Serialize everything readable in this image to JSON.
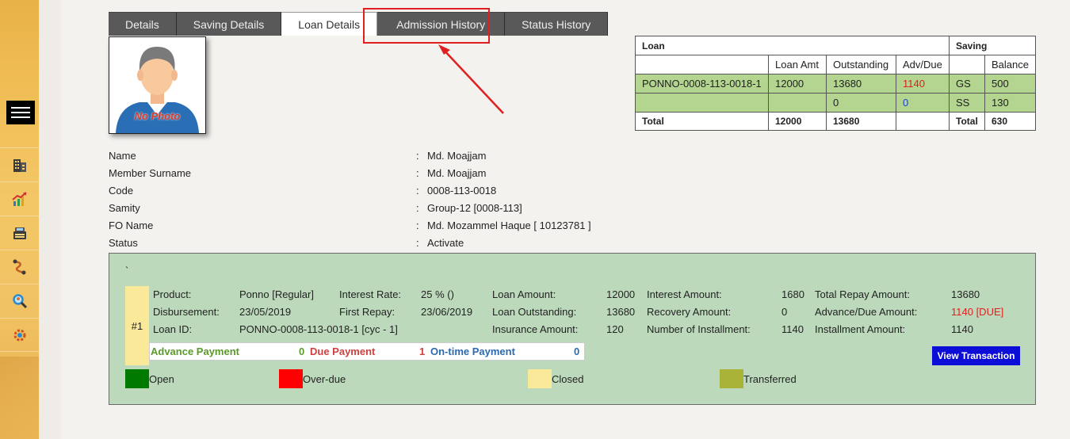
{
  "colors": {
    "sidebar": "#f0bd55",
    "tab_bg": "#595959",
    "panel_bg": "#bcdabb",
    "row_green": "#b3d58f",
    "highlight_outline": "#e02020",
    "button_blue": "#0d0dd8",
    "legend_open": "#007a00",
    "legend_overdue": "#ff0000",
    "legend_closed": "#fbe99a",
    "legend_transferred": "#a9b337"
  },
  "sidebar": {
    "menu_icon": "hamburger-menu-icon",
    "items": [
      {
        "icon": "building-icon"
      },
      {
        "icon": "chart-growth-icon"
      },
      {
        "icon": "cash-register-icon"
      },
      {
        "icon": "route-icon"
      },
      {
        "icon": "search-people-icon"
      },
      {
        "icon": "settings-gear-icon"
      }
    ]
  },
  "tabs": [
    {
      "label": "Details"
    },
    {
      "label": "Saving Details"
    },
    {
      "label": "Loan Details",
      "active": true
    },
    {
      "label": "Admission History"
    },
    {
      "label": "Status History"
    }
  ],
  "photo": {
    "placeholder_text": "No Photo"
  },
  "summary": {
    "loan_header": "Loan",
    "saving_header": "Saving",
    "col_loan_amt": "Loan Amt",
    "col_outstanding": "Outstanding",
    "col_adv_due": "Adv/Due",
    "col_balance": "Balance",
    "row1": {
      "loan_id": "PONNO-0008-113-0018-1",
      "loan_amt": "12000",
      "outstanding": "13680",
      "adv_due": "1140",
      "saving_type": "GS",
      "balance": "500"
    },
    "row2": {
      "loan_id": "",
      "loan_amt": "",
      "outstanding": "0",
      "adv_due": "0",
      "saving_type": "SS",
      "balance": "130"
    },
    "total": {
      "label": "Total",
      "loan_amt": "12000",
      "outstanding": "13680",
      "saving_label": "Total",
      "balance": "630"
    }
  },
  "member": {
    "rows": [
      {
        "label": "Name",
        "value": "Md. Moajjam"
      },
      {
        "label": "Member Surname",
        "value": "Md. Moajjam"
      },
      {
        "label": "Code",
        "value": "0008-113-0018"
      },
      {
        "label": "Samity",
        "value": "Group-12 [0008-113]"
      },
      {
        "label": "FO Name",
        "value": "Md. Mozammel Haque [ 10123781 ]"
      },
      {
        "label": "Status",
        "value": "Activate"
      }
    ],
    "colon": ":"
  },
  "loan": {
    "tick": "`",
    "cycle": "#1",
    "product_label": "Product:",
    "product": "Ponno [Regular]",
    "interest_rate_label": "Interest Rate:",
    "interest_rate": "25 % ()",
    "loan_amount_label": "Loan Amount:",
    "loan_amount": "12000",
    "interest_amount_label": "Interest Amount:",
    "interest_amount": "1680",
    "total_repay_label": "Total Repay Amount:",
    "total_repay": "13680",
    "disbursement_label": "Disbursement:",
    "disbursement": "23/05/2019",
    "first_repay_label": "First Repay:",
    "first_repay": "23/06/2019",
    "loan_outstanding_label": "Loan Outstanding:",
    "loan_outstanding": "13680",
    "recovery_amount_label": "Recovery Amount:",
    "recovery_amount": "0",
    "adv_due_amount_label": "Advance/Due Amount:",
    "adv_due_amount": "1140 [DUE]",
    "loan_id_label": "Loan ID:",
    "loan_id": "PONNO-0008-113-0018-1 [cyc - 1]",
    "insurance_amount_label": "Insurance Amount:",
    "insurance_amount": "120",
    "num_installment_label": "Number of Installment:",
    "num_installment": "1140",
    "installment_amount_label": "Installment Amount:",
    "installment_amount": "1140",
    "advance_payment_label": "Advance Payment",
    "advance_payment": "0",
    "due_payment_label": "Due Payment",
    "due_payment": "1",
    "ontime_payment_label": "On-time Payment",
    "ontime_payment": "0",
    "view_button": "View Transaction"
  },
  "legend": [
    {
      "label": "Open"
    },
    {
      "label": "Over-due"
    },
    {
      "label": "Closed"
    },
    {
      "label": "Transferred"
    }
  ]
}
